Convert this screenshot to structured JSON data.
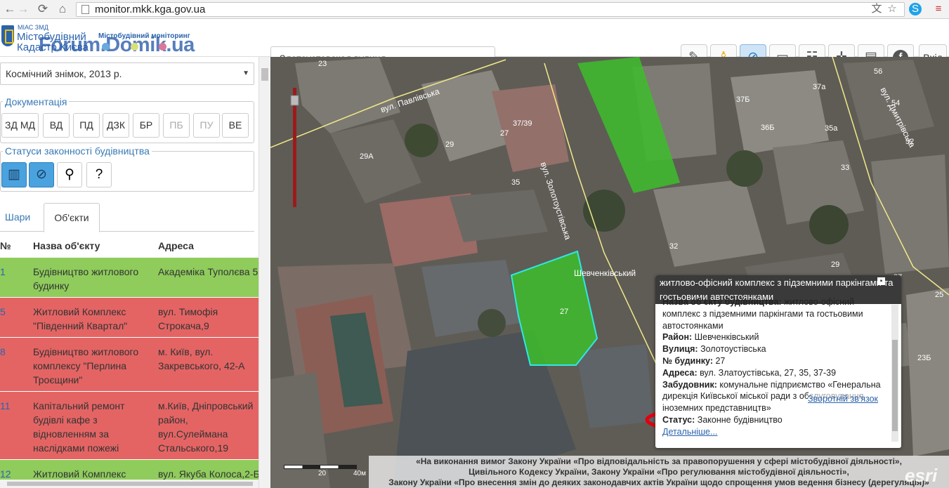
{
  "browser": {
    "url": "monitor.mkk.kga.gov.ua",
    "back_icon": "arrow-left-icon",
    "forward_icon": "arrow-right-icon",
    "reload_icon": "reload-icon",
    "home_icon": "home-icon"
  },
  "header": {
    "logo_small": "МІАС ЗМД",
    "logo_line1": "Містобудівний",
    "logo_line2": "Кадастр Києва",
    "subtitle": "Містобудівний моніторинг",
    "watermark": "Forum.Domik.ua",
    "search_value": "Златоустовская вулиця",
    "logout_label": "Вхід",
    "tools": [
      "edit-icon",
      "street-view-icon",
      "compass-icon",
      "ruler-icon",
      "layers-tree-icon",
      "crosshair-icon",
      "print-icon",
      "facebook-icon"
    ]
  },
  "sidebar": {
    "layer_select_value": "Космічний знімок, 2013 р.",
    "documentation_title": "Документація",
    "doc_buttons": [
      {
        "label": "ЗД МД",
        "enabled": true
      },
      {
        "label": "ВД",
        "enabled": true
      },
      {
        "label": "ПД",
        "enabled": true
      },
      {
        "label": "ДЗК",
        "enabled": true
      },
      {
        "label": "БР",
        "enabled": true
      },
      {
        "label": "ПБ",
        "enabled": false
      },
      {
        "label": "ПУ",
        "enabled": false
      },
      {
        "label": "ВЕ",
        "enabled": true
      }
    ],
    "status_title": "Статуси законності будівництва",
    "tabs": [
      "Шари",
      "Об'єкти"
    ],
    "active_tab": 1,
    "table_headers": {
      "num": "№",
      "name": "Назва об'єкту",
      "address": "Адреса"
    },
    "rows": [
      {
        "num": "1",
        "name": "Будівництво житлового будинку",
        "address": "Академіка Туполєва 5",
        "status": "green"
      },
      {
        "num": "5",
        "name": "Житловий Комплекс \"Південний Квартал\"",
        "address": "вул. Тимофія Строкача,9",
        "status": "red"
      },
      {
        "num": "8",
        "name": "Будівництво житлового комплексу \"Перлина Троєщини\"",
        "address": "м. Київ, вул. Закревського, 42-А",
        "status": "red"
      },
      {
        "num": "11",
        "name": "Капітальний ремонт будівлі кафе з відновленням за наслідками пожежі",
        "address": "м.Київ, Дніпровський район, вул.Сулеймана Стальського,19",
        "status": "red"
      },
      {
        "num": "12",
        "name": "Житловий Комплекс",
        "address": "вул. Якуба Колоса,2-Б",
        "status": "green"
      }
    ]
  },
  "map": {
    "streets": [
      "вул. Павлівська",
      "вул. Золотоустівська",
      "вул. Дмитрівська",
      "Шевченківський"
    ],
    "house_numbers": [
      "23",
      "27",
      "37/39",
      "29",
      "29А",
      "35",
      "37Б",
      "37а",
      "36Б",
      "35а",
      "56",
      "54",
      "52",
      "33",
      "32",
      "29",
      "27",
      "23Б",
      "25",
      "27"
    ],
    "scale_labels": [
      "20",
      "40м"
    ],
    "esri": "esri",
    "infowindow": {
      "title": "житлово-офісний комплекс з підземними паркінгами та гостьовими автостоянками",
      "name_label": "Назва об'єкту будівництва:",
      "name_value": "житлово-офісний комплекс з підземними паркінгами та гостьовими автостоянками",
      "district_label": "Район:",
      "district_value": "Шевченківський",
      "street_label": "Вулиця:",
      "street_value": "Золотоустівська",
      "house_label": "№ будинку:",
      "house_value": "27",
      "address_label": "Адреса:",
      "address_value": "вул. Златоустівська, 27, 35, 37-39",
      "developer_label": "Забудовник:",
      "developer_value": "комунальне підприємство «Генеральна дирекція Київської міської ради з обслуговування іноземних представництв»",
      "status_label": "Статус:",
      "status_value": "Законне будівництво",
      "link": "Зворотній зв'язок",
      "more_link": "Детальніше..."
    },
    "footer_law": [
      "«На виконання вимог Закону України «Про відповідальність за правопорушення у сфері містобудівної діяльності»,",
      "Цивільного Кодексу України, Закону України «Про регулювання містобудівної діяльності»,",
      "Закону України «Про внесення змін до деяких законодавчих актів України щодо спрощення умов ведення бізнесу (дерегуляція)»"
    ]
  },
  "colors": {
    "green_row": "#8fcc5c",
    "red_row": "#e46464",
    "accent": "#2b63ad",
    "parcel": "#3dbd2c",
    "parcel_outline": "#2ee7e7",
    "highlight": "#e0000f"
  }
}
